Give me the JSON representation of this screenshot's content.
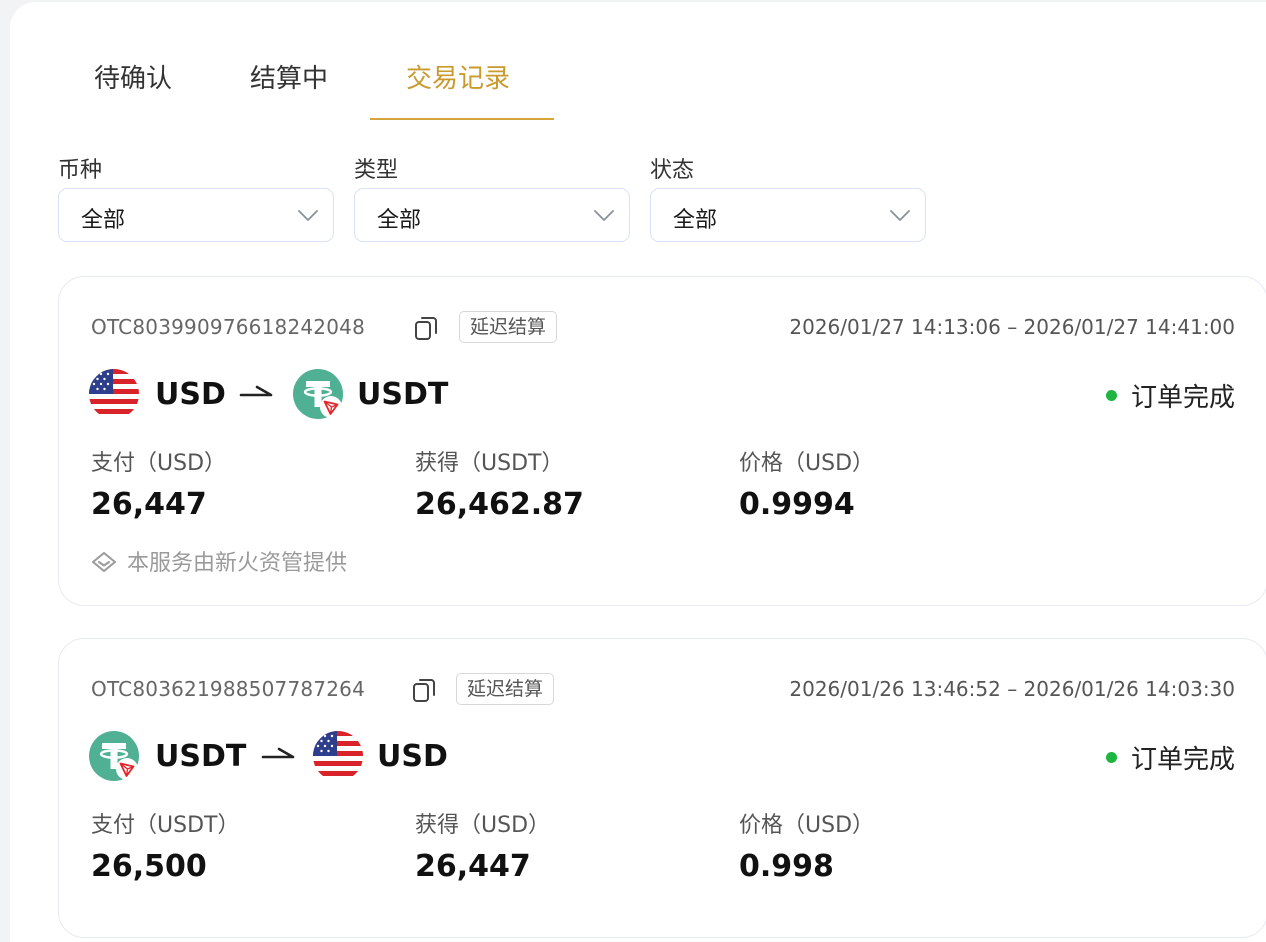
{
  "tabs": [
    {
      "label": "待确认",
      "active": false
    },
    {
      "label": "结算中",
      "active": false
    },
    {
      "label": "交易记录",
      "active": true
    }
  ],
  "accent_color": "#d6a43c",
  "filters": [
    {
      "label": "币种",
      "value": "全部"
    },
    {
      "label": "类型",
      "value": "全部"
    },
    {
      "label": "状态",
      "value": "全部"
    }
  ],
  "orders": [
    {
      "order_id": "OTC803990976618242048",
      "badge": "延迟结算",
      "time_range": "2026/01/27 14:13:06 – 2026/01/27 14:41:00",
      "from_currency": "USD",
      "from_icon": "us-flag-icon",
      "to_currency": "USDT",
      "to_icon": "tether-tron-icon",
      "status": "订单完成",
      "status_color": "#1fb541",
      "pay_label": "支付（USD）",
      "pay_value": "26,447",
      "receive_label": "获得（USDT）",
      "receive_value": "26,462.87",
      "price_label": "价格（USD）",
      "price_value": "0.9994",
      "provider_text": "本服务由新火资管提供"
    },
    {
      "order_id": "OTC803621988507787264",
      "badge": "延迟结算",
      "time_range": "2026/01/26 13:46:52 – 2026/01/26 14:03:30",
      "from_currency": "USDT",
      "from_icon": "tether-tron-icon",
      "to_currency": "USD",
      "to_icon": "us-flag-icon",
      "status": "订单完成",
      "status_color": "#1fb541",
      "pay_label": "支付（USDT）",
      "pay_value": "26,500",
      "receive_label": "获得（USD）",
      "receive_value": "26,447",
      "price_label": "价格（USD）",
      "price_value": "0.998"
    }
  ]
}
